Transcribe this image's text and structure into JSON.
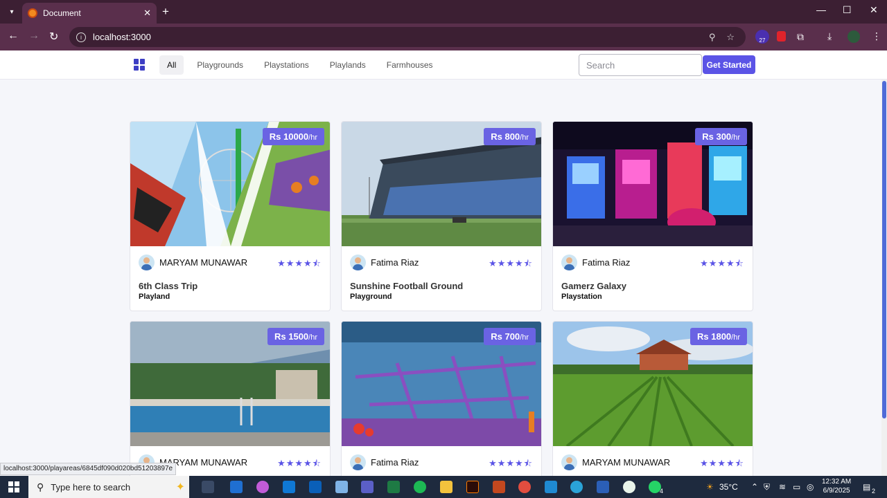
{
  "browser": {
    "tab_title": "Document",
    "url": "localhost:3000",
    "extension_badge_count": "27",
    "status_url": "localhost:3000/playareas/6845df090d020bd51203897e"
  },
  "nav": {
    "links": [
      {
        "label": "All",
        "active": true
      },
      {
        "label": "Playgrounds",
        "active": false
      },
      {
        "label": "Playstations",
        "active": false
      },
      {
        "label": "Playlands",
        "active": false
      },
      {
        "label": "Farmhouses",
        "active": false
      }
    ],
    "search_placeholder": "Search",
    "cta_label": "Get Started"
  },
  "cards": [
    {
      "price": "Rs 10000",
      "unit": "/hr",
      "owner": "MARYAM MUNAWAR",
      "rating": 4.5,
      "title": "6th Class Trip",
      "type": "Playland"
    },
    {
      "price": "Rs 800",
      "unit": "/hr",
      "owner": "Fatima Riaz",
      "rating": 4.5,
      "title": "Sunshine Football Ground",
      "type": "Playground"
    },
    {
      "price": "Rs 300",
      "unit": "/hr",
      "owner": "Fatima Riaz",
      "rating": 4.5,
      "title": "Gamerz Galaxy",
      "type": "Playstation"
    },
    {
      "price": "Rs 1500",
      "unit": "/hr",
      "owner": "MARYAM MUNAWAR",
      "rating": 4.5,
      "title": "",
      "type": ""
    },
    {
      "price": "Rs 700",
      "unit": "/hr",
      "owner": "Fatima Riaz",
      "rating": 4.5,
      "title": "",
      "type": ""
    },
    {
      "price": "Rs 1800",
      "unit": "/hr",
      "owner": "MARYAM MUNAWAR",
      "rating": 4.5,
      "title": "",
      "type": ""
    }
  ],
  "taskbar": {
    "search_placeholder": "Type here to search",
    "temperature": "35°C",
    "time": "12:32 AM",
    "date": "6/9/2025",
    "notification_count": "2",
    "whatsapp_badge": "4"
  },
  "colors": {
    "accent": "#5b54e6",
    "browser_frame": "#5a2f4c"
  }
}
